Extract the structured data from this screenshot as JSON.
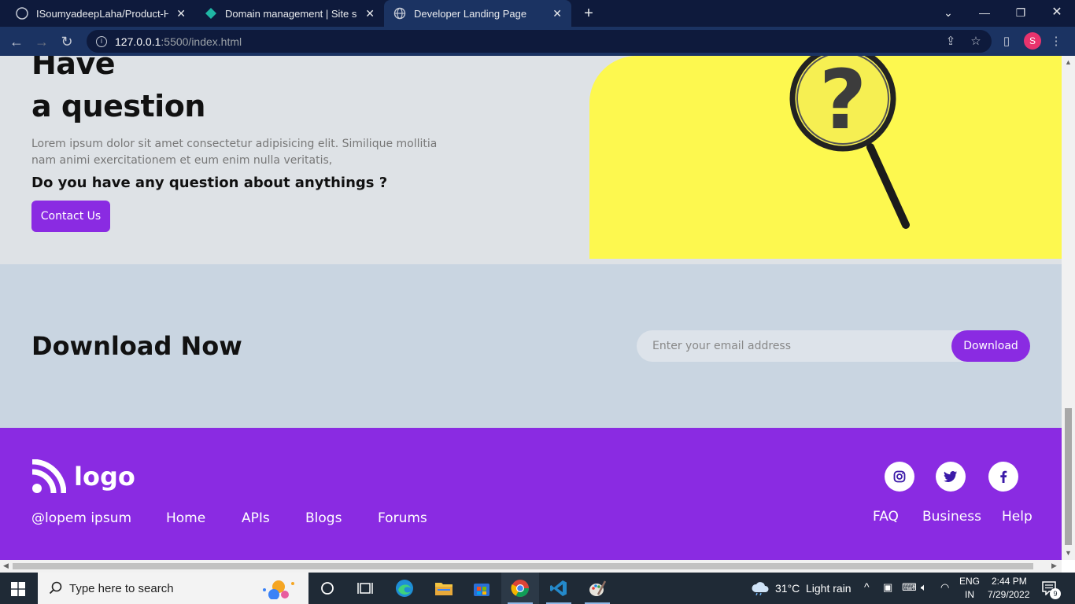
{
  "browser": {
    "tabs": [
      {
        "title": "ISoumyadeepLaha/Product-Hom",
        "icon": "github-icon"
      },
      {
        "title": "Domain management | Site settir",
        "icon": "netlify-icon"
      },
      {
        "title": "Developer Landing Page",
        "icon": "globe-icon"
      }
    ],
    "url_host": "127.0.0.1",
    "url_path": ":5500/index.html",
    "profile_initial": "S"
  },
  "question": {
    "title_line1": "Have",
    "title_line2": "a question",
    "description": "Lorem ipsum dolor sit amet consectetur adipisicing elit. Similique mollitia nam animi exercitationem et eum enim nulla veritatis,",
    "subheading": "Do you have any question about anythings ?",
    "contact_label": "Contact Us"
  },
  "download": {
    "title_bold": "Download",
    "title_light": "Now",
    "email_placeholder": "Enter your email address",
    "button_label": "Download"
  },
  "footer": {
    "logo_text": "logo",
    "handle": "@lopem ipsum",
    "nav_left": [
      "Home",
      "APIs",
      "Blogs",
      "Forums"
    ],
    "nav_right": [
      "FAQ",
      "Business",
      "Help"
    ],
    "social": [
      "instagram-icon",
      "twitter-icon",
      "facebook-icon"
    ]
  },
  "taskbar": {
    "search_placeholder": "Type here to search",
    "weather_temp": "31°C",
    "weather_desc": "Light rain",
    "lang_line1": "ENG",
    "lang_line2": "IN",
    "time": "2:44 PM",
    "date": "7/29/2022",
    "notification_count": "9"
  },
  "colors": {
    "accent": "#8a2be2",
    "question_bg": "#dee2e6",
    "download_bg": "#c9d5e1",
    "image_yellow": "#fdf84f"
  }
}
